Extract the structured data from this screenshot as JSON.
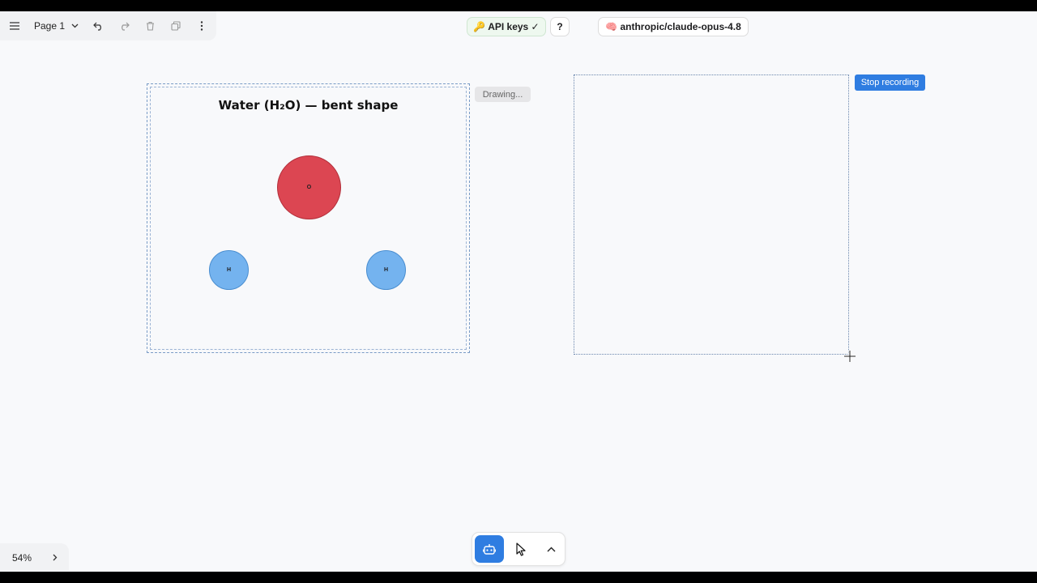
{
  "toolbar": {
    "page_label": "Page 1"
  },
  "header": {
    "api_keys_label": "🔑 API keys ✓",
    "help_label": "?",
    "model_label": "🧠 anthropic/claude-opus-4.8"
  },
  "canvas": {
    "left_frame": {
      "title": "Water (H₂O) — bent shape",
      "atoms": [
        {
          "label": "O",
          "color": "#dc4652"
        },
        {
          "label": "H",
          "color": "#74b3ef"
        },
        {
          "label": "H",
          "color": "#74b3ef"
        }
      ]
    },
    "drawing_status": "Drawing...",
    "stop_recording_label": "Stop recording"
  },
  "footer": {
    "zoom_label": "54%"
  },
  "colors": {
    "accent": "#2f7de1",
    "oxygen": "#dc4652",
    "hydrogen": "#74b3ef"
  }
}
